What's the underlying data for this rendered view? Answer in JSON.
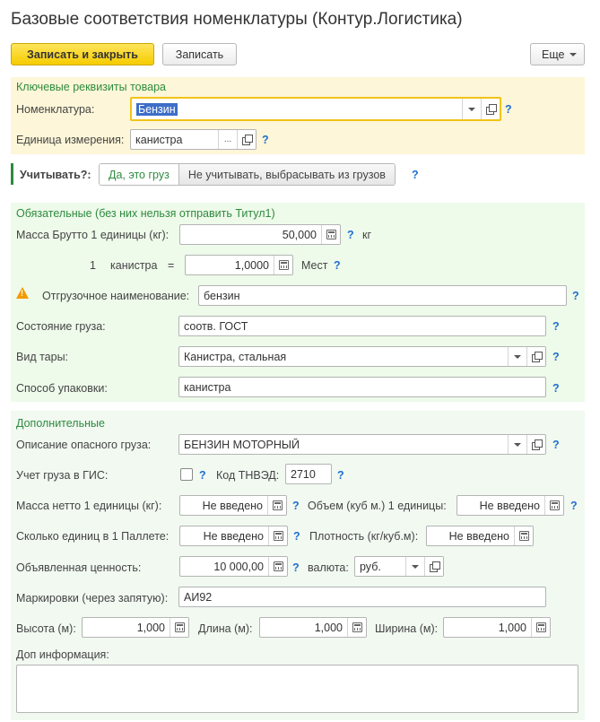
{
  "title": "Базовые соответствия номенклатуры (Контур.Логистика)",
  "toolbar": {
    "save_close": "Записать и закрыть",
    "save": "Записать",
    "more": "Еще"
  },
  "key_group": {
    "title": "Ключевые реквизиты товара",
    "nomenclature_label": "Номенклатура:",
    "nomenclature_value": "Бензин",
    "unit_label": "Единица измерения:",
    "unit_value": "канистра"
  },
  "account": {
    "label": "Учитывать?:",
    "yes": "Да, это груз",
    "no": "Не учитывать, выбрасывать из грузов"
  },
  "required_group": {
    "title": "Обязательные (без них нельзя отправить Титул1)",
    "gross_label": "Масса Брутто 1 единицы (кг):",
    "gross_value": "50,000",
    "gross_unit": "кг",
    "qty": "1",
    "qty_unit": "канистра",
    "eq": "=",
    "places_value": "1,0000",
    "places_unit": "Мест",
    "shipping_label": "Отгрузочное наименование:",
    "shipping_value": "бензин",
    "state_label": "Состояние груза:",
    "state_value": "соотв. ГОСТ",
    "tare_label": "Вид тары:",
    "tare_value": "Канистра, стальная",
    "pack_label": "Способ упаковки:",
    "pack_value": "канистра"
  },
  "extra_group": {
    "title": "Дополнительные",
    "danger_label": "Описание опасного груза:",
    "danger_value": "БЕНЗИН МОТОРНЫЙ",
    "gis_label": "Учет груза в ГИС:",
    "tnved_label": "Код ТНВЭД:",
    "tnved_value": "2710",
    "net_label": "Масса нетто 1 единицы (кг):",
    "net_value": "Не введено",
    "volume_label": "Объем (куб м.) 1 единицы:",
    "volume_value": "Не введено",
    "pallet_label": "Сколько единиц в 1 Паллете:",
    "pallet_value": "Не введено",
    "density_label": "Плотность (кг/куб.м):",
    "density_value": "Не введено",
    "declared_label": "Объявленная ценность:",
    "declared_value": "10 000,00",
    "currency_label": "валюта:",
    "currency_value": "руб.",
    "marks_label": "Маркировки (через запятую):",
    "marks_value": "АИ92",
    "height_label": "Высота (м):",
    "height_value": "1,000",
    "length_label": "Длина (м):",
    "length_value": "1,000",
    "width_label": "Ширина (м):",
    "width_value": "1,000",
    "info_label": "Доп информация:",
    "info_value": ""
  },
  "help": "?",
  "ellipsis": "...",
  "colors": {
    "accent_green": "#2e8b3e",
    "primary_button": "#f5cc00",
    "help": "#1f6fcf"
  }
}
